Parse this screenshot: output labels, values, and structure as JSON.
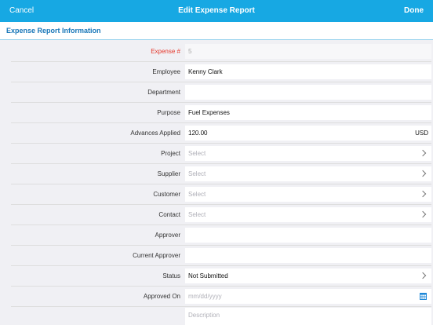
{
  "nav": {
    "cancel": "Cancel",
    "title": "Edit Expense Report",
    "done": "Done"
  },
  "section": {
    "title": "Expense Report Information"
  },
  "fields": {
    "expense_no": {
      "label": "Expense #",
      "value": "5"
    },
    "employee": {
      "label": "Employee",
      "value": "Kenny Clark"
    },
    "department": {
      "label": "Department",
      "value": ""
    },
    "purpose": {
      "label": "Purpose",
      "value": "Fuel Expenses"
    },
    "advances": {
      "label": "Advances Applied",
      "value": "120.00",
      "unit": "USD"
    },
    "project": {
      "label": "Project",
      "placeholder": "Select"
    },
    "supplier": {
      "label": "Supplier",
      "placeholder": "Select"
    },
    "customer": {
      "label": "Customer",
      "placeholder": "Select"
    },
    "contact": {
      "label": "Contact",
      "placeholder": "Select"
    },
    "approver": {
      "label": "Approver",
      "value": ""
    },
    "current_approver": {
      "label": "Current Approver",
      "value": ""
    },
    "status": {
      "label": "Status",
      "value": "Not Submitted"
    },
    "approved_on": {
      "label": "Approved On",
      "placeholder": "mm/dd/yyyy"
    },
    "description": {
      "placeholder": "Description"
    }
  },
  "icons": {
    "chevron": "chevron-right-icon",
    "calendar": "calendar-icon"
  },
  "colors": {
    "nav_bar": "#17a8e3",
    "section_title": "#1776b8",
    "required_label": "#e5372b",
    "calendar_icon": "#1e88d8"
  }
}
